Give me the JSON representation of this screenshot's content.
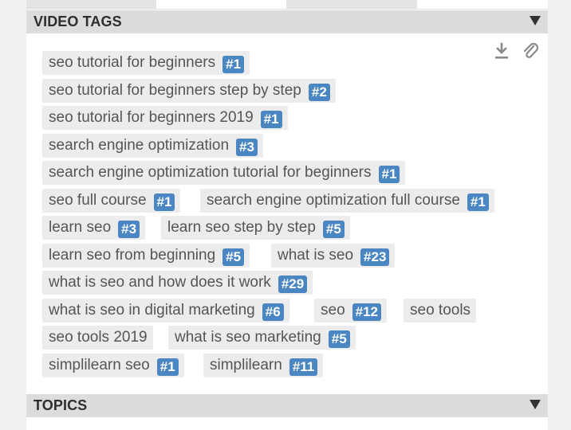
{
  "video_tags": {
    "title": "VIDEO TAGS",
    "collapse_icon": "triangle-down-icon",
    "download_icon": "download-icon",
    "attach_icon": "paperclip-icon",
    "tags": [
      {
        "label": "seo tutorial for beginners",
        "rank": "#1"
      },
      {
        "label": "seo tutorial for beginners step by step",
        "rank": "#2"
      },
      {
        "label": "seo tutorial for beginners 2019",
        "rank": "#1"
      },
      {
        "label": "search engine optimization",
        "rank": "#3"
      },
      {
        "label": "search engine optimization tutorial for beginners",
        "rank": "#1"
      },
      {
        "label": "seo full course",
        "rank": "#1"
      },
      {
        "label": "search engine optimization full course",
        "rank": "#1"
      },
      {
        "label": "learn seo",
        "rank": "#3"
      },
      {
        "label": "learn seo step by step",
        "rank": "#5"
      },
      {
        "label": "learn seo from beginning",
        "rank": "#5"
      },
      {
        "label": "what is seo",
        "rank": "#23"
      },
      {
        "label": "what is seo and how does it work",
        "rank": "#29"
      },
      {
        "label": "what is seo in digital marketing",
        "rank": "#6"
      },
      {
        "label": "seo",
        "rank": "#12"
      },
      {
        "label": "seo tools",
        "rank": ""
      },
      {
        "label": "seo tools 2019",
        "rank": ""
      },
      {
        "label": "what is seo marketing",
        "rank": "#5"
      },
      {
        "label": "simplilearn seo",
        "rank": "#1"
      },
      {
        "label": "simplilearn",
        "rank": "#11"
      }
    ]
  },
  "topics": {
    "title": "TOPICS",
    "collapse_icon": "triangle-down-icon"
  },
  "colors": {
    "header_bg": "#dcdcdc",
    "tag_bg": "#ececec",
    "badge_bg": "#4a87c2",
    "badge_text": "#ffffff"
  }
}
